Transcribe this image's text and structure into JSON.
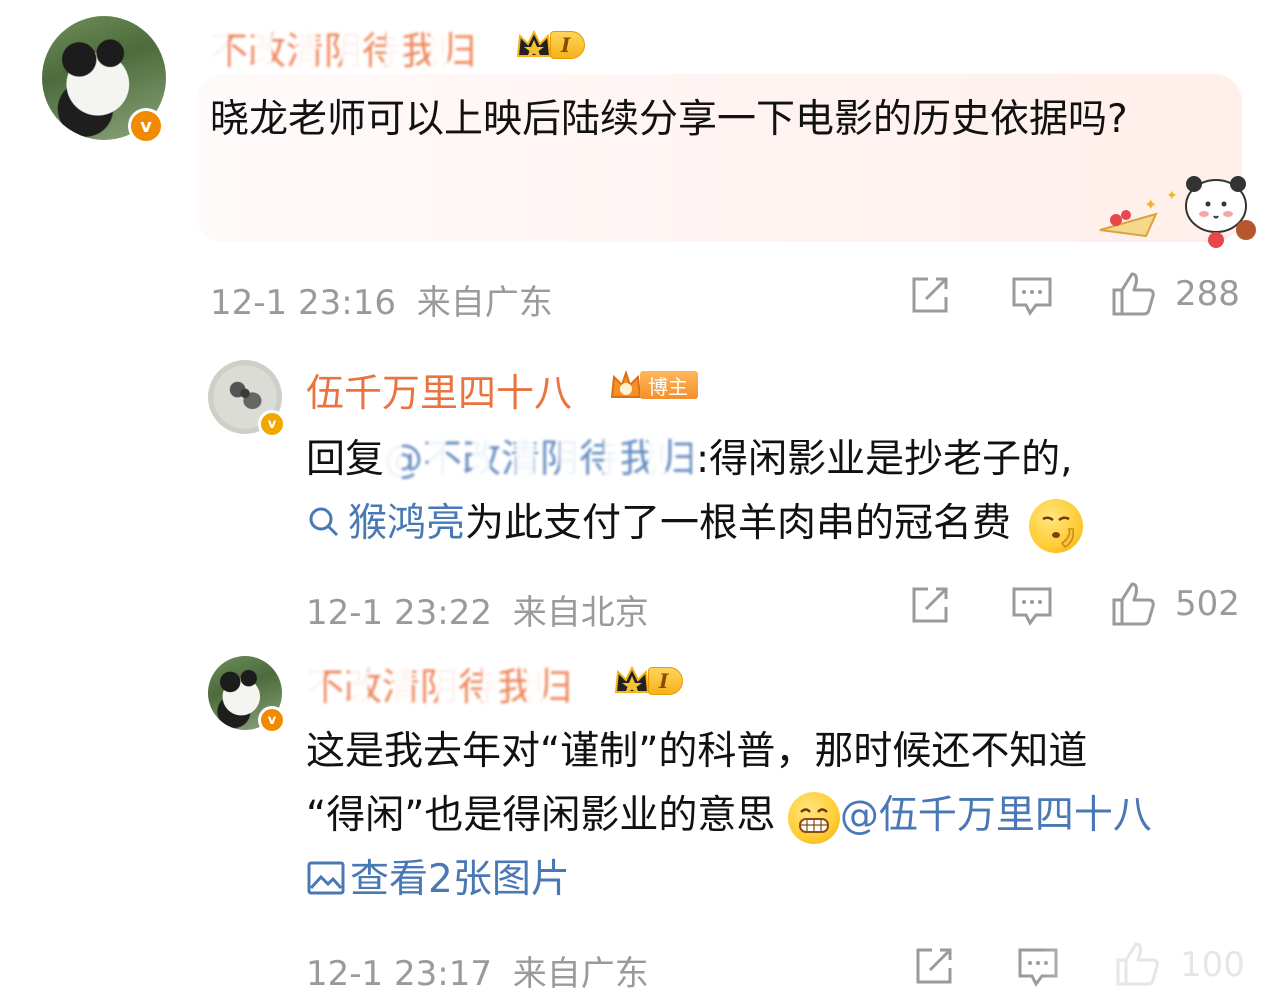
{
  "comments": [
    {
      "username": "不改清阴待我归",
      "badge_text": "I",
      "text": "晓龙老师可以上映后陆续分享一下电影的历史依据吗?",
      "time": "12-1 23:16",
      "location": "来自广东",
      "likes": "288"
    },
    {
      "username": "伍千万里四十八",
      "badge_text": "博主",
      "reply_prefix": "回复",
      "reply_mention": "@不改清阴待我归",
      "text_part1": ":得闲影业是抄老子的,",
      "search_term": "猴鸿亮",
      "text_part2": "为此支付了一根羊肉串的冠名费",
      "time": "12-1 23:22",
      "location": "来自北京",
      "likes": "502"
    },
    {
      "username": "不改清阴待我归",
      "badge_text": "I",
      "text_part1": "这是我去年对“谨制”的科普，那时候还不知道",
      "text_part2": "“得闲”也是得闲影业的意思",
      "mention": "@伍千万里四十八",
      "view_images": "查看2张图片",
      "time": "12-1 23:17",
      "location": "来自广东",
      "likes": "100"
    }
  ],
  "colors": {
    "username": "#eb7340",
    "link": "#4a78b5",
    "meta": "#9a9a9a",
    "vip_badge": "#f08a00"
  },
  "icons": [
    "share-icon",
    "comment-icon",
    "like-icon",
    "search-icon",
    "image-icon",
    "crown-icon",
    "verified-icon"
  ]
}
